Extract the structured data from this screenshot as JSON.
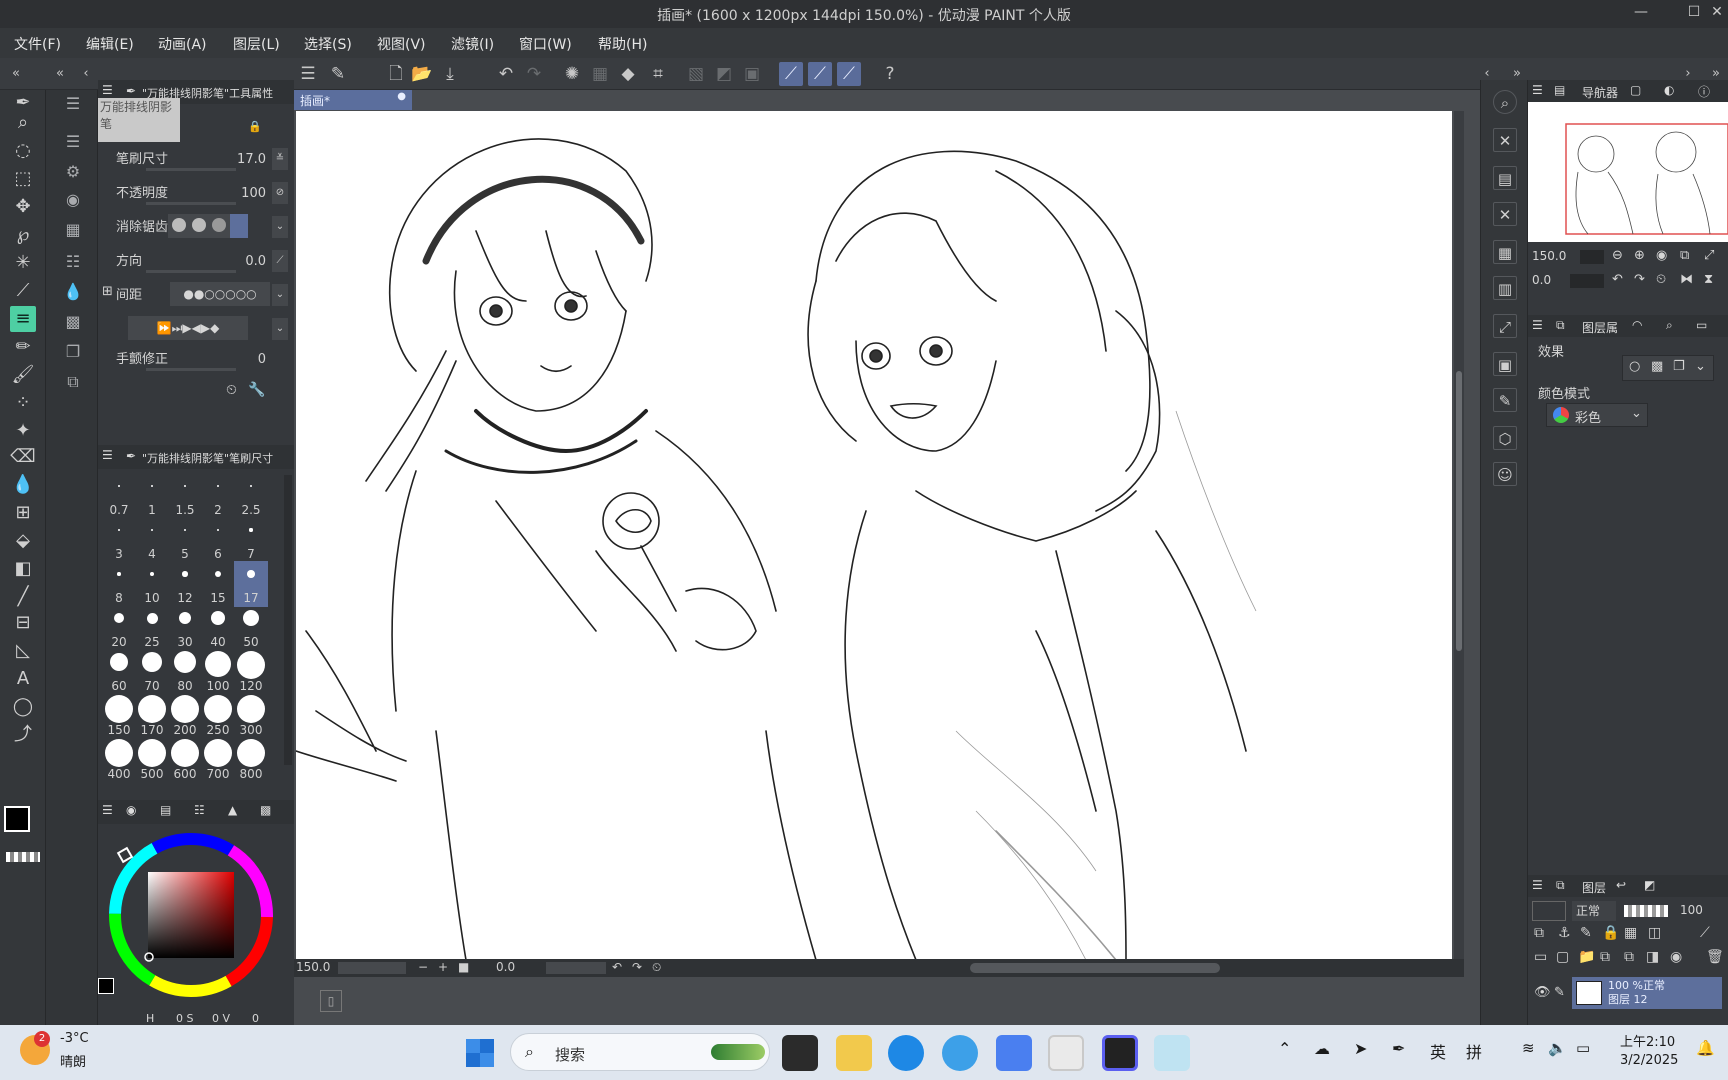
{
  "window": {
    "title": "插画* (1600 x 1200px 144dpi 150.0%)  - 优动漫 PAINT 个人版"
  },
  "menu": [
    "文件(F)",
    "编辑(E)",
    "动画(A)",
    "图层(L)",
    "选择(S)",
    "视图(V)",
    "滤镜(I)",
    "窗口(W)",
    "帮助(H)"
  ],
  "tool_property": {
    "header": "\"万能排线阴影笔\"工具属性",
    "preset_name": "万能排线阴影笔",
    "rows": [
      {
        "label": "笔刷尺寸",
        "value": "17.0"
      },
      {
        "label": "不透明度",
        "value": "100"
      },
      {
        "label": "消除锯齿",
        "value": ""
      },
      {
        "label": "方向",
        "value": "0.0"
      },
      {
        "label": "间距",
        "value": ""
      },
      {
        "label": "",
        "value": ""
      },
      {
        "label": "手颤修正",
        "value": "0"
      }
    ]
  },
  "brush_size_panel": {
    "header": "\"万能排线阴影笔\"笔刷尺寸",
    "sizes": [
      "0.7",
      "1",
      "1.5",
      "2",
      "2.5",
      "3",
      "4",
      "5",
      "6",
      "7",
      "8",
      "10",
      "12",
      "15",
      "17",
      "20",
      "25",
      "30",
      "40",
      "50",
      "60",
      "70",
      "80",
      "100",
      "120",
      "150",
      "170",
      "200",
      "250",
      "300",
      "400",
      "500",
      "600",
      "700",
      "800"
    ],
    "selected": "17"
  },
  "color_panel": {
    "h_label": "H",
    "s_label": "0 S",
    "v_label": "0 V",
    "extra": "0",
    "main_color": "#000000",
    "sub_color": "#6b4b4b"
  },
  "canvas": {
    "doc_tab": "插画*",
    "zoom": "150.0",
    "angle": "0.0"
  },
  "navigator": {
    "tab": "导航器",
    "zoom": "150.0",
    "angle": "0.0"
  },
  "layer_property": {
    "tab": "图层属",
    "effect_label": "效果",
    "color_mode_label": "颜色模式",
    "color_mode_value": "彩色"
  },
  "layers": {
    "tab": "图层",
    "blend_mode": "正常",
    "opacity": "100",
    "layer_line1": "100 %正常",
    "layer_line2": "图层 12"
  },
  "taskbar": {
    "weather_temp": "-3°C",
    "weather_desc": "晴朗",
    "weather_badge": "2",
    "search_placeholder": "搜索",
    "ime_lang": "英",
    "ime_mode": "拼",
    "time": "上午2:10",
    "date": "3/2/2025"
  }
}
